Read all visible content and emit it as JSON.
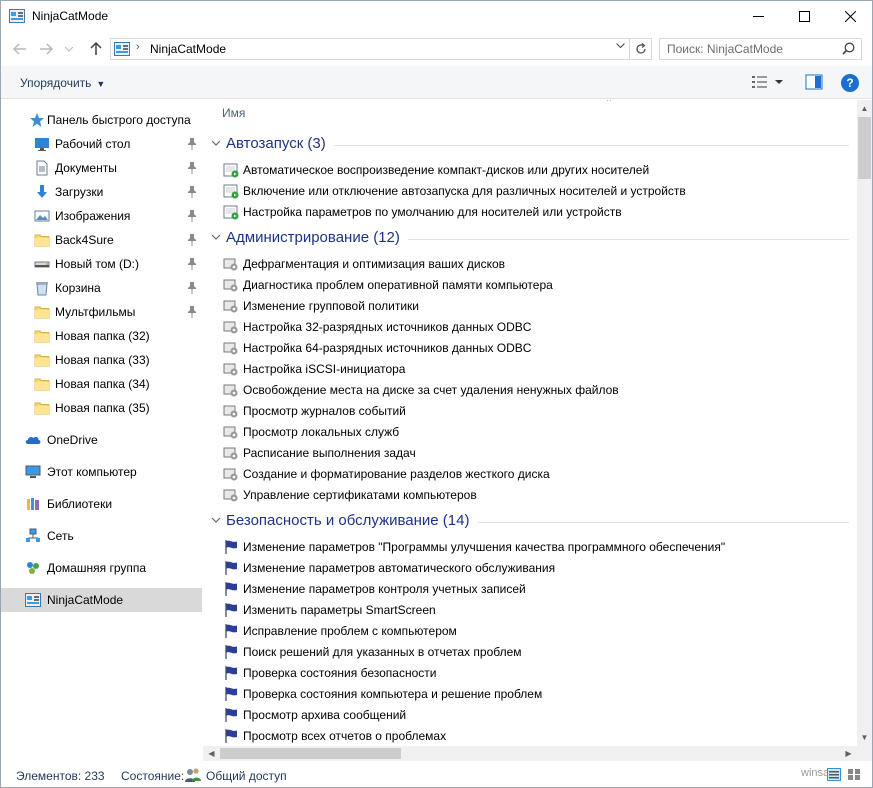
{
  "window": {
    "title": "NinjaCatMode",
    "minimize": "—",
    "maximize": "☐",
    "close": "✕"
  },
  "address": {
    "path": "NinjaCatMode",
    "separator": "›",
    "search_placeholder": "Поиск: NinjaCatMode"
  },
  "toolbar": {
    "organize_label": "Упорядочить",
    "help_label": "?"
  },
  "sidebar": {
    "quick_access": "Панель быстрого доступа",
    "pinned": [
      {
        "label": "Рабочий стол",
        "icon": "desktop-icon",
        "pinned": true
      },
      {
        "label": "Документы",
        "icon": "documents-icon",
        "pinned": true
      },
      {
        "label": "Загрузки",
        "icon": "downloads-icon",
        "pinned": true
      },
      {
        "label": "Изображения",
        "icon": "pictures-icon",
        "pinned": true
      },
      {
        "label": "Back4Sure",
        "icon": "folder-icon",
        "pinned": true
      },
      {
        "label": "Новый том (D:)",
        "icon": "drive-icon",
        "pinned": true
      },
      {
        "label": "Корзина",
        "icon": "recycle-bin-icon",
        "pinned": true
      },
      {
        "label": "Мультфильмы",
        "icon": "folder-icon",
        "pinned": true
      },
      {
        "label": "Новая папка (32)",
        "icon": "folder-icon",
        "pinned": false
      },
      {
        "label": "Новая папка (33)",
        "icon": "folder-icon",
        "pinned": false
      },
      {
        "label": "Новая папка (34)",
        "icon": "folder-icon",
        "pinned": false
      },
      {
        "label": "Новая папка (35)",
        "icon": "folder-icon",
        "pinned": false
      }
    ],
    "roots": [
      {
        "label": "OneDrive",
        "icon": "onedrive-icon"
      },
      {
        "label": "Этот компьютер",
        "icon": "computer-icon"
      },
      {
        "label": "Библиотеки",
        "icon": "libraries-icon"
      },
      {
        "label": "Сеть",
        "icon": "network-icon"
      },
      {
        "label": "Домашняя группа",
        "icon": "homegroup-icon"
      },
      {
        "label": "NinjaCatMode",
        "icon": "control-panel-icon",
        "selected": true
      }
    ]
  },
  "content": {
    "column_header": "Имя",
    "groups": [
      {
        "title": "Автозапуск (3)",
        "icon": "autoplay-icon",
        "items": [
          "Автоматическое воспроизведение компакт-дисков или других носителей",
          "Включение или отключение автозапуска для различных носителей и устройств",
          "Настройка параметров по умолчанию для носителей или устройств"
        ]
      },
      {
        "title": "Администрирование (12)",
        "icon": "admin-tools-icon",
        "items": [
          "Дефрагментация и оптимизация ваших дисков",
          "Диагностика проблем оперативной памяти компьютера",
          "Изменение групповой политики",
          "Настройка 32-разрядных источников данных ODBC",
          "Настройка 64-разрядных источников данных ODBC",
          "Настройка iSCSI-инициатора",
          "Освобождение места на диске за счет удаления ненужных файлов",
          "Просмотр журналов событий",
          "Просмотр локальных служб",
          "Расписание выполнения задач",
          "Создание и форматирование разделов жесткого диска",
          "Управление сертификатами компьютеров"
        ]
      },
      {
        "title": "Безопасность и обслуживание (14)",
        "icon": "flag-icon",
        "items": [
          "Изменение параметров \"Программы улучшения качества программного обеспечения\"",
          "Изменение параметров автоматического обслуживания",
          "Изменение параметров контроля учетных записей",
          "Изменить параметры SmartScreen",
          "Исправление проблем с компьютером",
          "Поиск решений для указанных в отчетах проблем",
          "Проверка состояния безопасности",
          "Проверка состояния компьютера и решение проблем",
          "Просмотр архива сообщений",
          "Просмотр всех отчетов о проблемах"
        ]
      }
    ]
  },
  "status": {
    "items_count": "Элементов: 233",
    "state_label": "Состояние:",
    "state_value": "Общий доступ",
    "watermark": "winsa.ru"
  }
}
